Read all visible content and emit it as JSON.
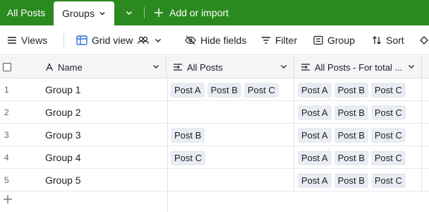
{
  "tabs": {
    "all_posts": "All Posts",
    "groups": "Groups",
    "add_or_import": "Add or import"
  },
  "toolbar": {
    "views": "Views",
    "grid_view": "Grid view",
    "hide_fields": "Hide fields",
    "filter": "Filter",
    "group": "Group",
    "sort": "Sort"
  },
  "columns": {
    "name": "Name",
    "all_posts": "All Posts",
    "all_posts_total": "All Posts - For total ..."
  },
  "rows": [
    {
      "num": "1",
      "name": "Group 1",
      "all_posts": [
        "Post A",
        "Post B",
        "Post C"
      ],
      "total": [
        "Post A",
        "Post B",
        "Post C"
      ]
    },
    {
      "num": "2",
      "name": "Group 2",
      "all_posts": [],
      "total": [
        "Post A",
        "Post B",
        "Post C"
      ]
    },
    {
      "num": "3",
      "name": "Group 3",
      "all_posts": [
        "Post B"
      ],
      "total": [
        "Post A",
        "Post B",
        "Post C"
      ]
    },
    {
      "num": "4",
      "name": "Group 4",
      "all_posts": [
        "Post C"
      ],
      "total": [
        "Post A",
        "Post B",
        "Post C"
      ]
    },
    {
      "num": "5",
      "name": "Group 5",
      "all_posts": [],
      "total": [
        "Post A",
        "Post B",
        "Post C"
      ]
    }
  ],
  "colors": {
    "tabbar": "#2a8a1f",
    "chip": "#e9ecf2"
  }
}
